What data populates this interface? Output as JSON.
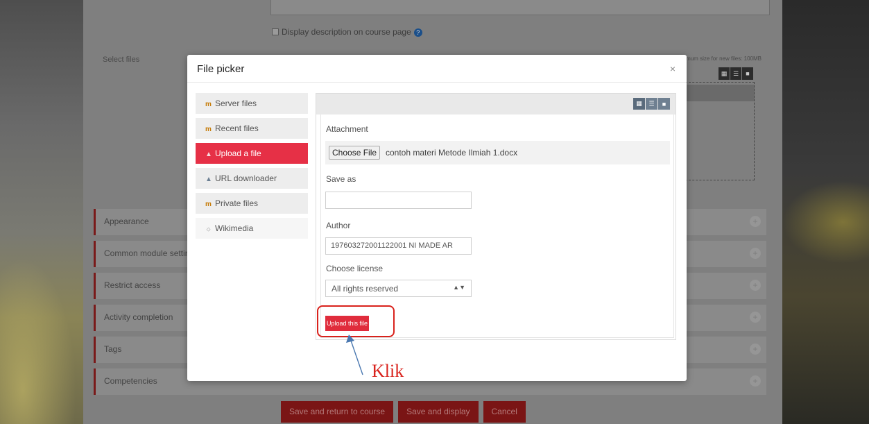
{
  "background_page": {
    "display_description": "Display description on course page",
    "select_files_label": "Select files",
    "max_size_text": "Maximum size for new files: 100MB",
    "sections": [
      {
        "label": "Appearance"
      },
      {
        "label": "Common module settings"
      },
      {
        "label": "Restrict access"
      },
      {
        "label": "Activity completion"
      },
      {
        "label": "Tags"
      },
      {
        "label": "Competencies"
      }
    ],
    "buttons": {
      "save_return": "Save and return to course",
      "save_display": "Save and display",
      "cancel": "Cancel"
    }
  },
  "modal": {
    "title": "File picker",
    "close": "×",
    "repositories": [
      {
        "label": "Server files",
        "icon": "moodle-icon"
      },
      {
        "label": "Recent files",
        "icon": "moodle-icon"
      },
      {
        "label": "Upload a file",
        "icon": "upload-icon",
        "active": true
      },
      {
        "label": "URL downloader",
        "icon": "url-icon"
      },
      {
        "label": "Private files",
        "icon": "moodle-icon"
      },
      {
        "label": "Wikimedia",
        "icon": "wikimedia-icon"
      }
    ],
    "form": {
      "attachment_label": "Attachment",
      "choose_file_button": "Choose File",
      "chosen_file": "contoh materi Metode Ilmiah 1.docx",
      "save_as_label": "Save as",
      "save_as_value": "",
      "author_label": "Author",
      "author_value": "197603272001122001 NI MADE AR",
      "license_label": "Choose license",
      "license_value": "All rights reserved",
      "upload_button": "Upload this file"
    }
  },
  "annotation": {
    "text": "Klik",
    "color": "#d9221c"
  },
  "colors": {
    "accent": "#e63046",
    "upload_button": "#e02c3c",
    "view_buttons": "#6f8091"
  }
}
